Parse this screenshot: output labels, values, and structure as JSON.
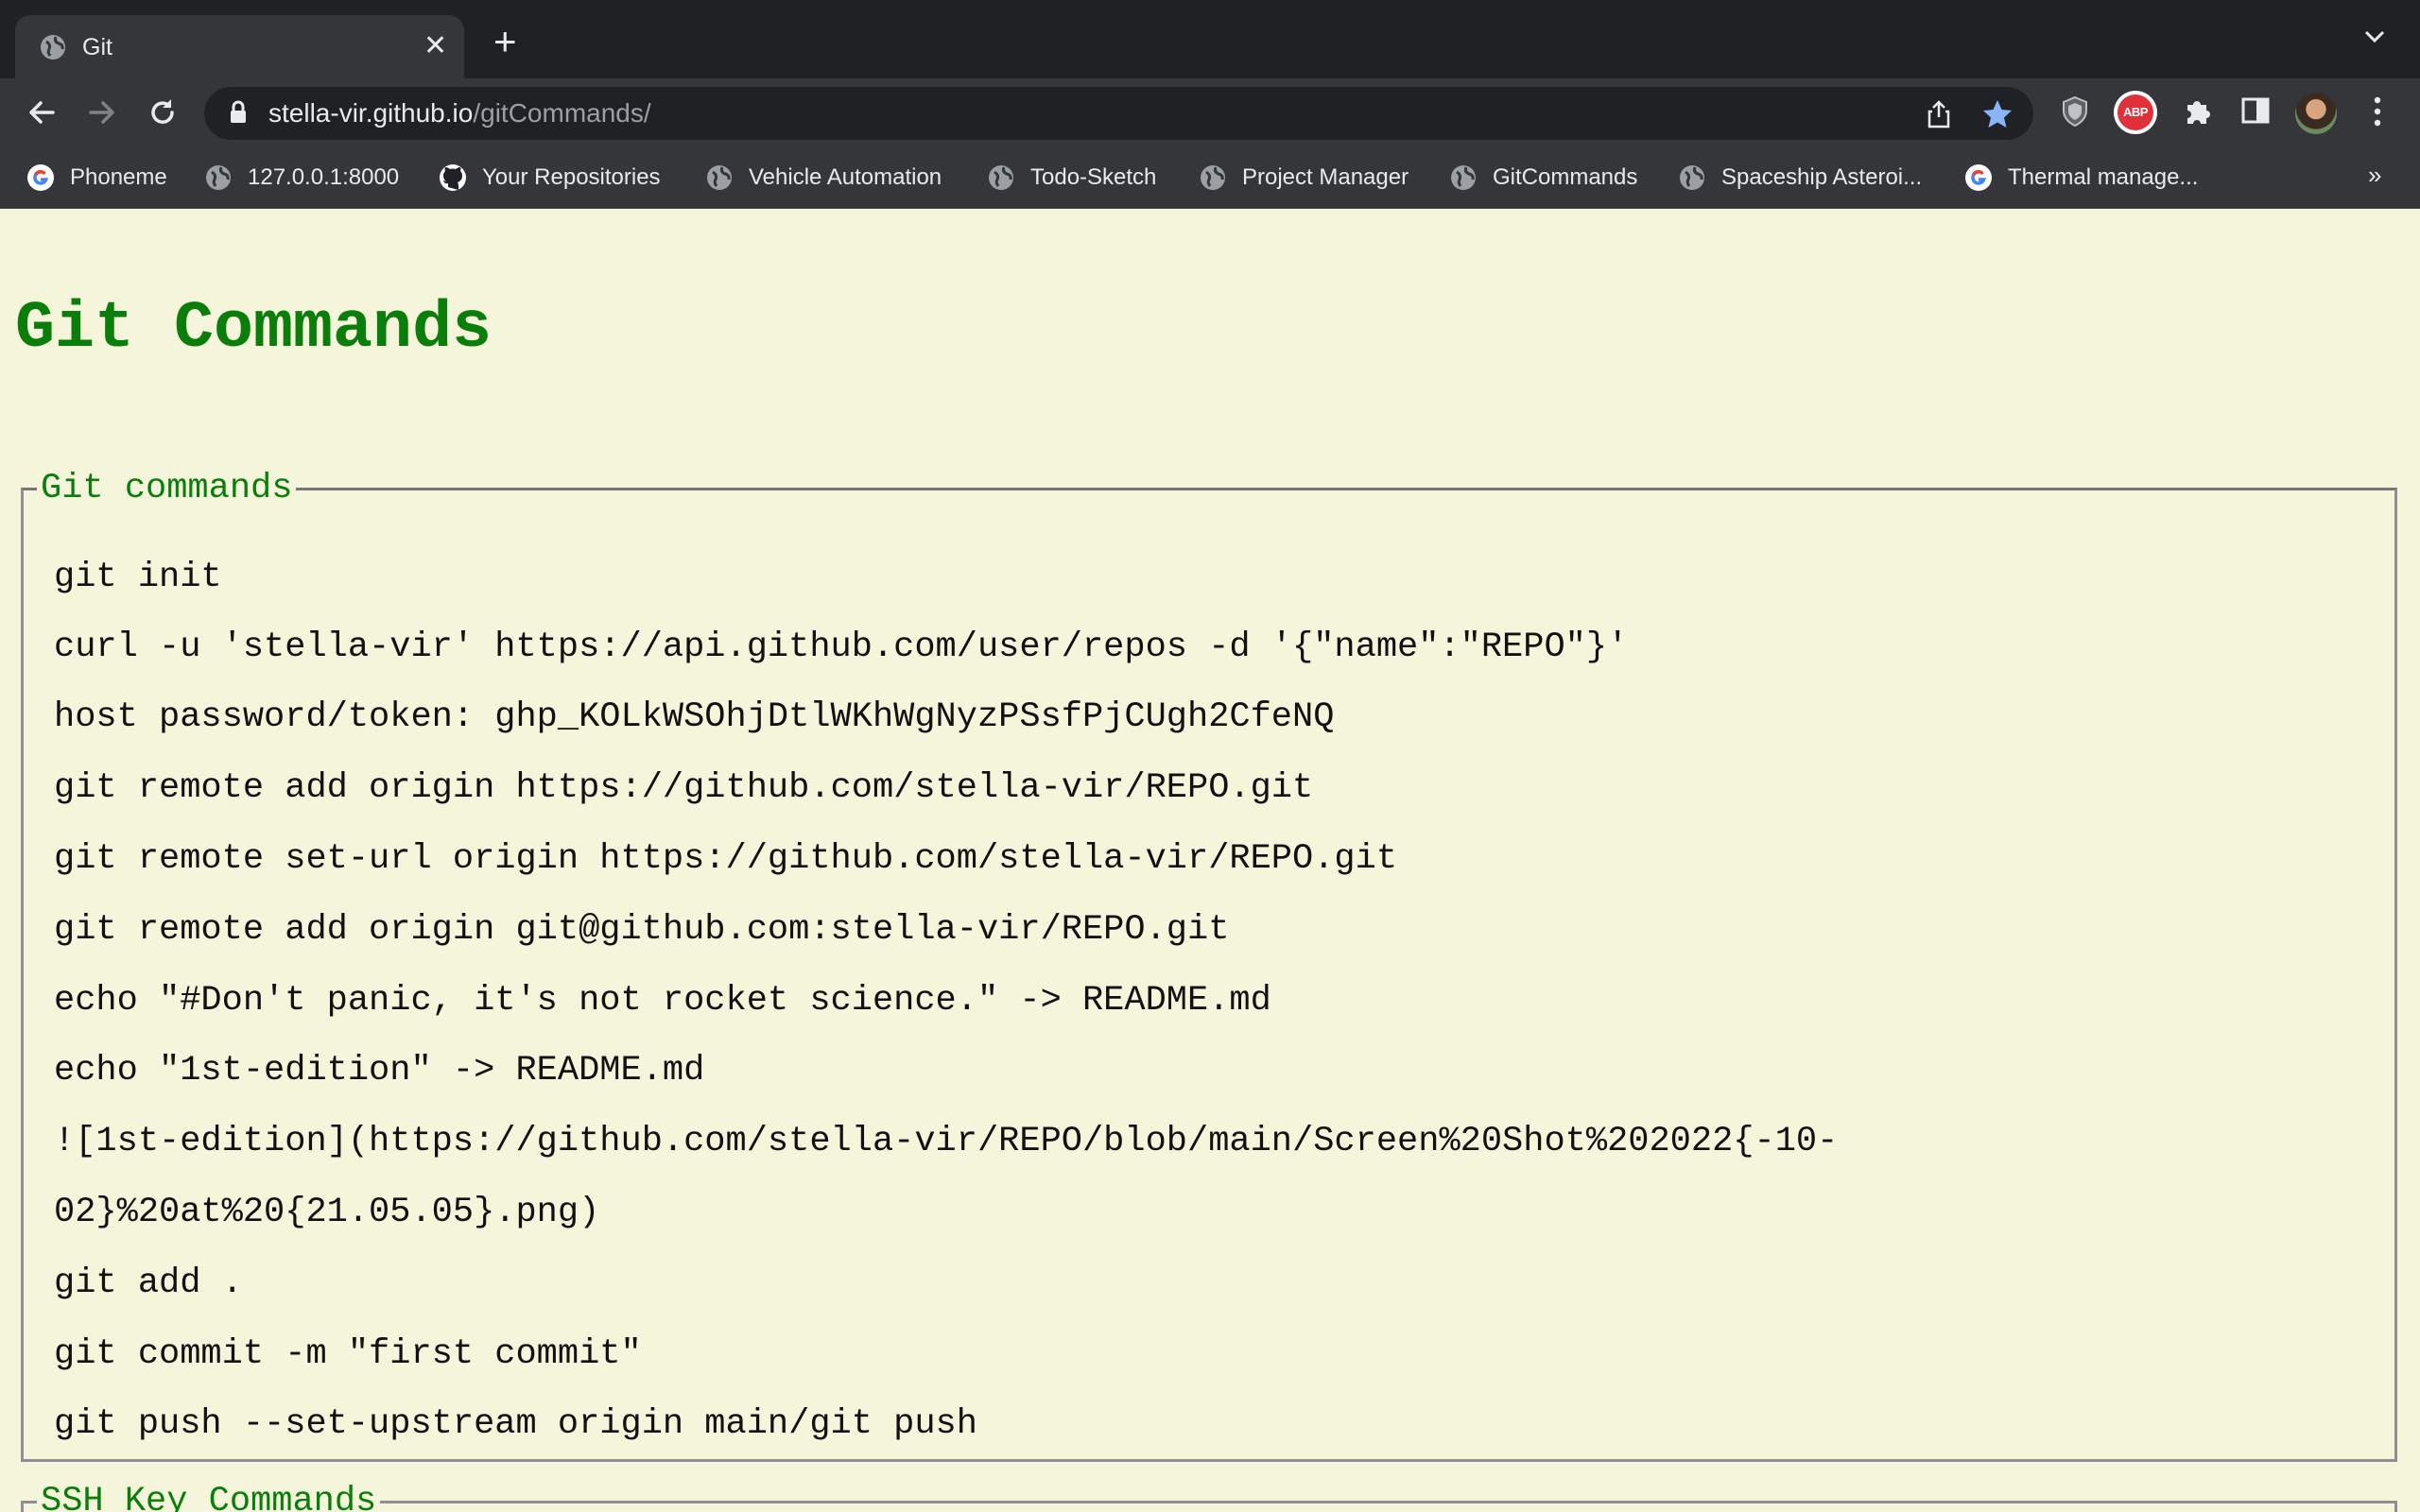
{
  "browser": {
    "tab": {
      "title": "Git"
    },
    "address": {
      "host": "stella-vir.github.io",
      "path": "/gitCommands/"
    },
    "bookmarks": [
      {
        "label": "Phoneme",
        "icon": "google-icon"
      },
      {
        "label": "127.0.0.1:8000",
        "icon": "globe-icon"
      },
      {
        "label": "Your Repositories",
        "icon": "github-icon"
      },
      {
        "label": "Vehicle Automation",
        "icon": "globe-icon"
      },
      {
        "label": "Todo-Sketch",
        "icon": "globe-icon"
      },
      {
        "label": "Project Manager",
        "icon": "globe-icon"
      },
      {
        "label": "GitCommands",
        "icon": "globe-icon"
      },
      {
        "label": "Spaceship Asteroi...",
        "icon": "globe-icon"
      },
      {
        "label": "Thermal manage...",
        "icon": "google-icon"
      }
    ],
    "extensions": {
      "adblock_label": "ABP"
    },
    "colors": {
      "accent_star": "#8ab4f8",
      "abp_red": "#e0313a"
    }
  },
  "page": {
    "title": "Git Commands",
    "git_section": {
      "legend": "Git commands",
      "commands": [
        "git init",
        "curl -u 'stella-vir' https://api.github.com/user/repos -d '{\"name\":\"REPO\"}'",
        "host password/token: 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",
        "git remote add origin https://github.com/stella-vir/REPO.git",
        "git remote set-url origin https://github.com/stella-vir/REPO.git",
        "git remote add origin git@github.com:stella-vir/REPO.git",
        "echo \"#Don't panic, it's not rocket science.\" -> README.md",
        "echo \"1st-edition\" -> README.md",
        "![1st-edition](https://github.com/stella-vir/REPO/blob/main/Screen%20Shot%202022{-10-",
        "02}%20at%20{21.05.05}.png)",
        "git add .",
        "git commit -m \"first commit\"",
        "git push --set-upstream origin main/git push"
      ]
    },
    "ssh_section": {
      "legend": "SSH Key Commands"
    },
    "colors": {
      "title_green": "#0a7d0a",
      "background": "#f5f5dc"
    }
  }
}
